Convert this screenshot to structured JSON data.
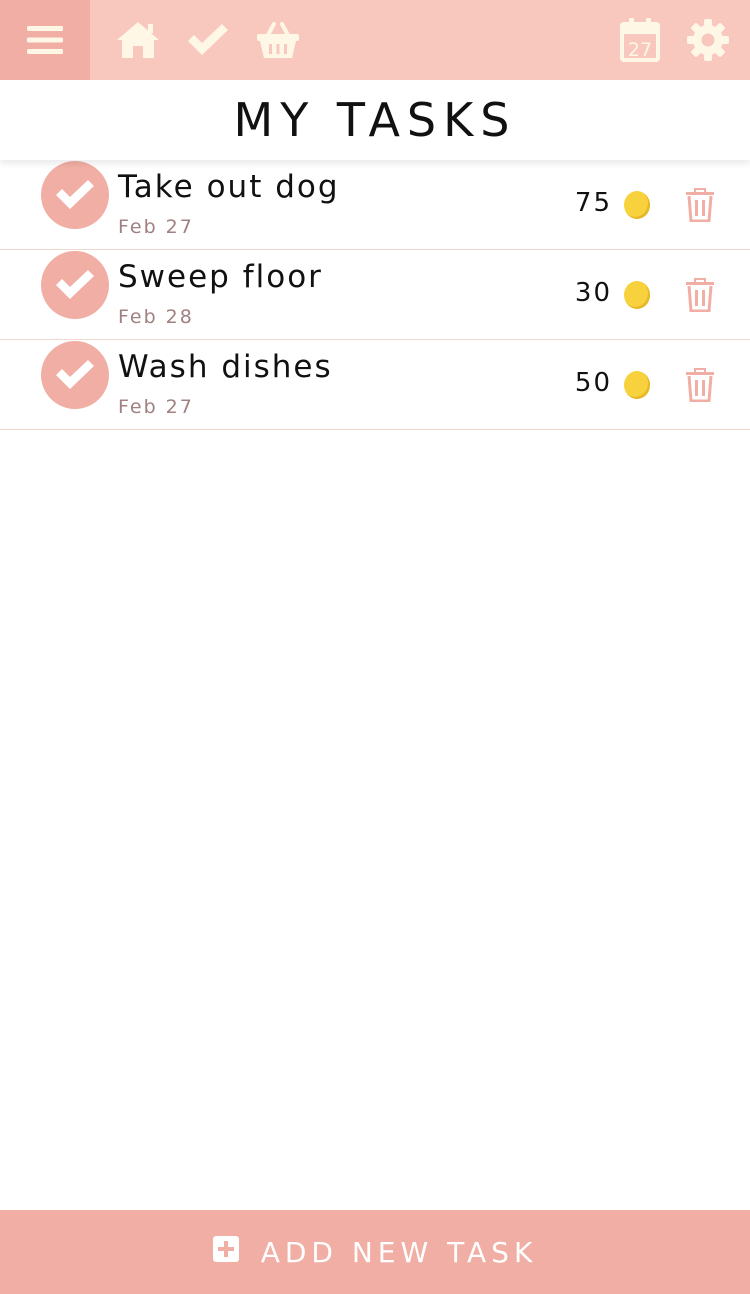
{
  "header": {
    "icons": [
      "hamburger-menu-icon",
      "home-icon",
      "checkmark-icon",
      "basket-icon",
      "calendar-icon",
      "gear-icon"
    ],
    "calendar_day": "27",
    "colors": {
      "bar": "#f8c8be",
      "menu": "#f1aea4",
      "icon": "#fff7e6"
    }
  },
  "page": {
    "title": "MY TASKS"
  },
  "tasks": [
    {
      "title": "Take out dog",
      "date": "Feb 27",
      "points": "75"
    },
    {
      "title": "Sweep floor",
      "date": "Feb 28",
      "points": "30"
    },
    {
      "title": "Wash dishes",
      "date": "Feb 27",
      "points": "50"
    }
  ],
  "footer": {
    "add_label": "ADD NEW TASK"
  },
  "colors": {
    "accent": "#f1aea4",
    "coin": "#f7d23c",
    "date_text": "#a08080"
  }
}
